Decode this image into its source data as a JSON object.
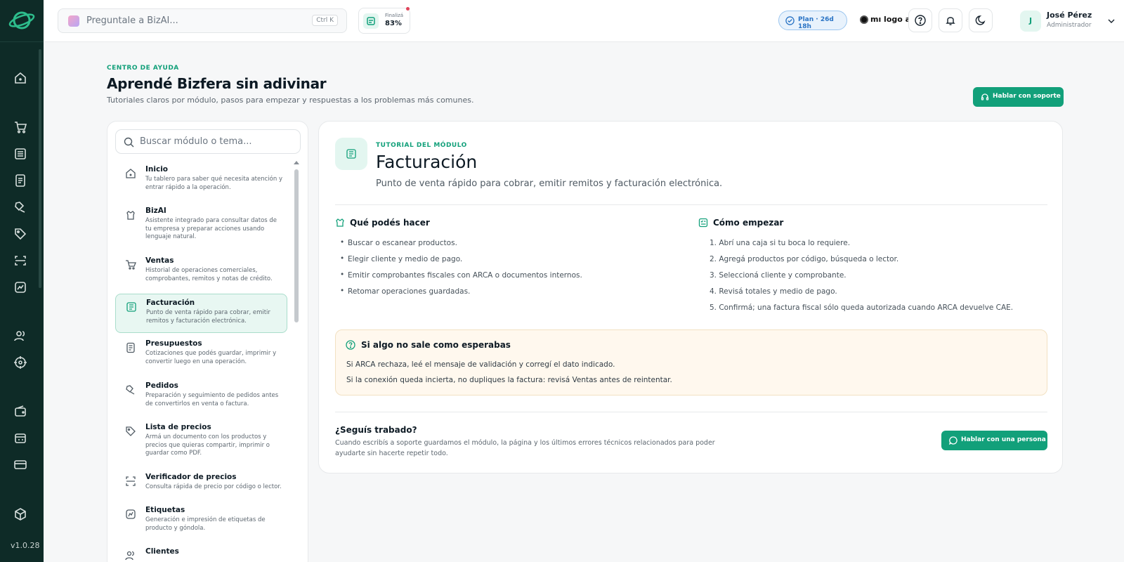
{
  "app": {
    "version": "v1.0.28"
  },
  "sidebar_icons": [
    "home-icon",
    "cart-icon",
    "list-icon",
    "document-icon",
    "bag-icon",
    "tag-icon",
    "scan-icon",
    "chart-icon",
    "users-icon",
    "target-icon",
    "wallet-icon",
    "cash-register-icon",
    "card-icon",
    "box-icon"
  ],
  "topbar": {
    "search_placeholder": "Preguntale a BizAI...",
    "search_shortcut": "Ctrl K",
    "progress_label": "Finalizá",
    "progress_value": "83%",
    "plan_label": "Plan · 26d 18h",
    "brand_label": "mı logo acá",
    "user_initial": "J",
    "user_name": "José Pérez",
    "user_role": "Administrador"
  },
  "header": {
    "eyebrow": "CENTRO DE AYUDA",
    "title": "Aprendé Bizfera sin adivinar",
    "subtitle": "Tutoriales claros por módulo, pasos para empezar y respuestas a los problemas más comunes.",
    "support_button": "Hablar con soporte"
  },
  "modules_panel": {
    "search_placeholder": "Buscar módulo o tema...",
    "items": [
      {
        "title": "Inicio",
        "description": "Tu tablero para saber qué necesita atención y entrar rápido a la operación."
      },
      {
        "title": "BizAI",
        "description": "Asistente integrado para consultar datos de tu empresa y preparar acciones usando lenguaje natural."
      },
      {
        "title": "Ventas",
        "description": "Historial de operaciones comerciales, comprobantes, remitos y notas de crédito."
      },
      {
        "title": "Facturación",
        "description": "Punto de venta rápido para cobrar, emitir remitos y facturación electrónica."
      },
      {
        "title": "Presupuestos",
        "description": "Cotizaciones que podés guardar, imprimir y convertir luego en una operación."
      },
      {
        "title": "Pedidos",
        "description": "Preparación y seguimiento de pedidos antes de convertirlos en venta o factura."
      },
      {
        "title": "Lista de precios",
        "description": "Armá un documento con los productos y precios que quieras compartir, imprimir o guardar como PDF."
      },
      {
        "title": "Verificador de precios",
        "description": "Consulta rápida de precio por código o lector."
      },
      {
        "title": "Etiquetas",
        "description": "Generación e impresión de etiquetas de producto y góndola."
      },
      {
        "title": "Clientes",
        "description": ""
      }
    ]
  },
  "tutorial": {
    "eyebrow": "TUTORIAL DEL MÓDULO",
    "title": "Facturación",
    "subtitle": "Punto de venta rápido para cobrar, emitir remitos y facturación electrónica.",
    "can_do_title": "Qué podés hacer",
    "can_do": [
      "Buscar o escanear productos.",
      "Elegir cliente y medio de pago.",
      "Emitir comprobantes fiscales con ARCA o documentos internos.",
      "Retomar operaciones guardadas."
    ],
    "start_title": "Cómo empezar",
    "steps": [
      "1. Abrí una caja si tu boca lo requiere.",
      "2. Agregá productos por código, búsqueda o lector.",
      "3. Seleccioná cliente y comprobante.",
      "4. Revisá totales y medio de pago.",
      "5. Confirmá; una factura fiscal sólo queda autorizada cuando ARCA devuelve CAE."
    ],
    "trouble_title": "Si algo no sale como esperabas",
    "trouble_lines": [
      "Si ARCA rechaza, leé el mensaje de validación y corregí el dato indicado.",
      "Si la conexión queda incierta, no dupliques la factura: revisá Ventas antes de reintentar."
    ],
    "stuck_title": "¿Seguís trabado?",
    "stuck_desc": "Cuando escribís a soporte guardamos el módulo, la página y los últimos errores técnicos relacionados para poder ayudarte sin hacerte repetir todo.",
    "person_button": "Hablar con una persona"
  },
  "colors": {
    "accent": "#12a07a",
    "rail": "#0e2b27",
    "plan": "#2a74c5"
  }
}
